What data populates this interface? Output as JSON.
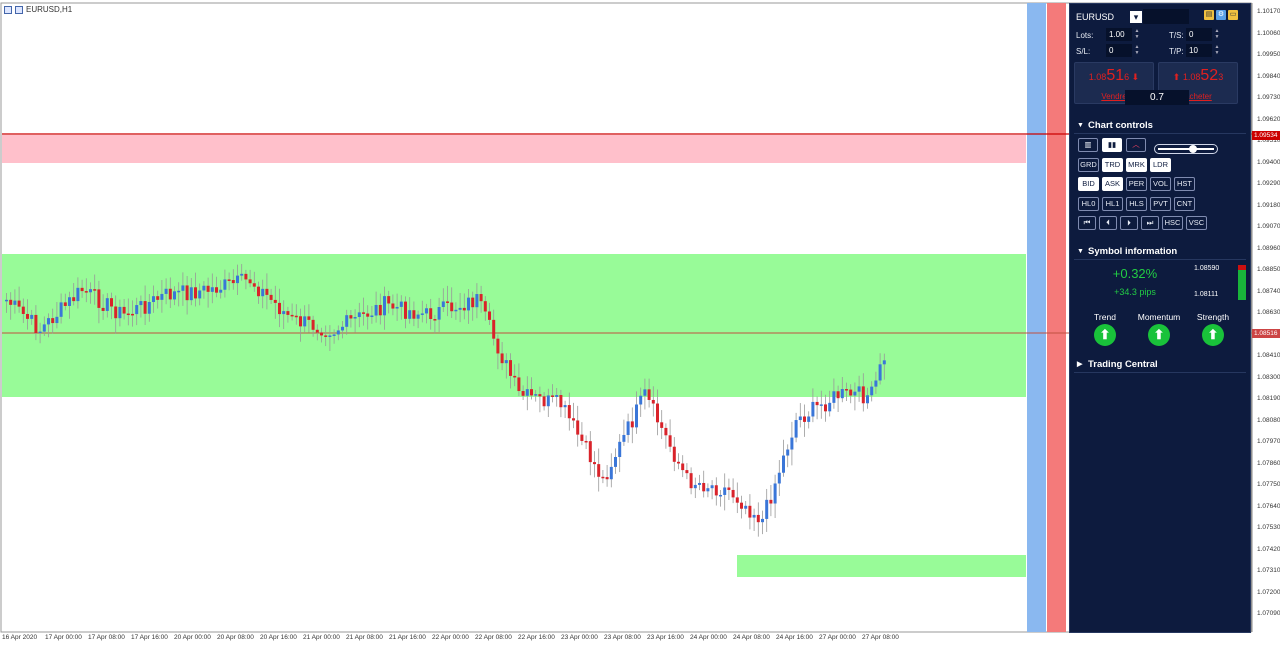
{
  "chart": {
    "title": "EURUSD,H1",
    "current_price_tag": "1.08516",
    "red_line_tag": "1.09534",
    "x_labels": [
      "16 Apr 2020",
      "17 Apr 00:00",
      "17 Apr 08:00",
      "17 Apr 16:00",
      "20 Apr 00:00",
      "20 Apr 08:00",
      "20 Apr 16:00",
      "21 Apr 00:00",
      "21 Apr 08:00",
      "21 Apr 16:00",
      "22 Apr 00:00",
      "22 Apr 08:00",
      "22 Apr 16:00",
      "23 Apr 00:00",
      "23 Apr 08:00",
      "23 Apr 16:00",
      "24 Apr 00:00",
      "24 Apr 08:00",
      "24 Apr 16:00",
      "27 Apr 00:00",
      "27 Apr 08:00"
    ],
    "y_labels": [
      "1.10170",
      "1.10060",
      "1.09950",
      "1.09840",
      "1.09730",
      "1.09620",
      "1.09510",
      "1.09400",
      "1.09290",
      "1.09180",
      "1.09070",
      "1.08960",
      "1.08850",
      "1.08740",
      "1.08630",
      "1.08520",
      "1.08410",
      "1.08300",
      "1.08190",
      "1.08080",
      "1.07970",
      "1.07860",
      "1.07750",
      "1.07640",
      "1.07530",
      "1.07420",
      "1.07310",
      "1.07200",
      "1.07090"
    ],
    "colors": {
      "bull": "#3a76d8",
      "bear": "#d9232a",
      "zone_red": "#ffc0cb",
      "zone_green": "#98fb98",
      "line_red": "#cc0000",
      "strip_blue": "#8ab8f0",
      "strip_red": "#f47a7a"
    }
  },
  "panel": {
    "symbol": "EURUSD",
    "dropdown_icon": "chevron-down-icon",
    "lots_label": "Lots:",
    "lots_value": "1.00",
    "ts_label": "T/S:",
    "ts_value": "0",
    "sl_label": "S/L:",
    "sl_value": "0",
    "tp_label": "T/P:",
    "tp_value": "10",
    "sell": {
      "prefix": "1.08",
      "big": "51",
      "suffix": "6",
      "label": "Vendre"
    },
    "buy": {
      "prefix": "1.08",
      "big": "52",
      "suffix": "3",
      "label": "Acheter"
    },
    "lot_display": "0.7",
    "chart_controls": {
      "title": "Chart controls",
      "row1": [
        "GRD",
        "TRD",
        "MRK",
        "LDR"
      ],
      "row2": [
        "BID",
        "ASK",
        "PER",
        "VOL",
        "HST"
      ],
      "row3": [
        "HL0",
        "HL1",
        "HLS",
        "PVT",
        "CNT"
      ],
      "row4": [
        "⏮",
        "⏴",
        "⏵",
        "⏭",
        "HSC",
        "VSC"
      ]
    },
    "symbol_info": {
      "title": "Symbol information",
      "change_pct": "+0.32%",
      "change_pips": "+34.3 pips",
      "high": "1.08590",
      "low": "1.08111",
      "trend_label": "Trend",
      "momentum_label": "Momentum",
      "strength_label": "Strength"
    },
    "trading_central": {
      "title": "Trading Central"
    }
  }
}
